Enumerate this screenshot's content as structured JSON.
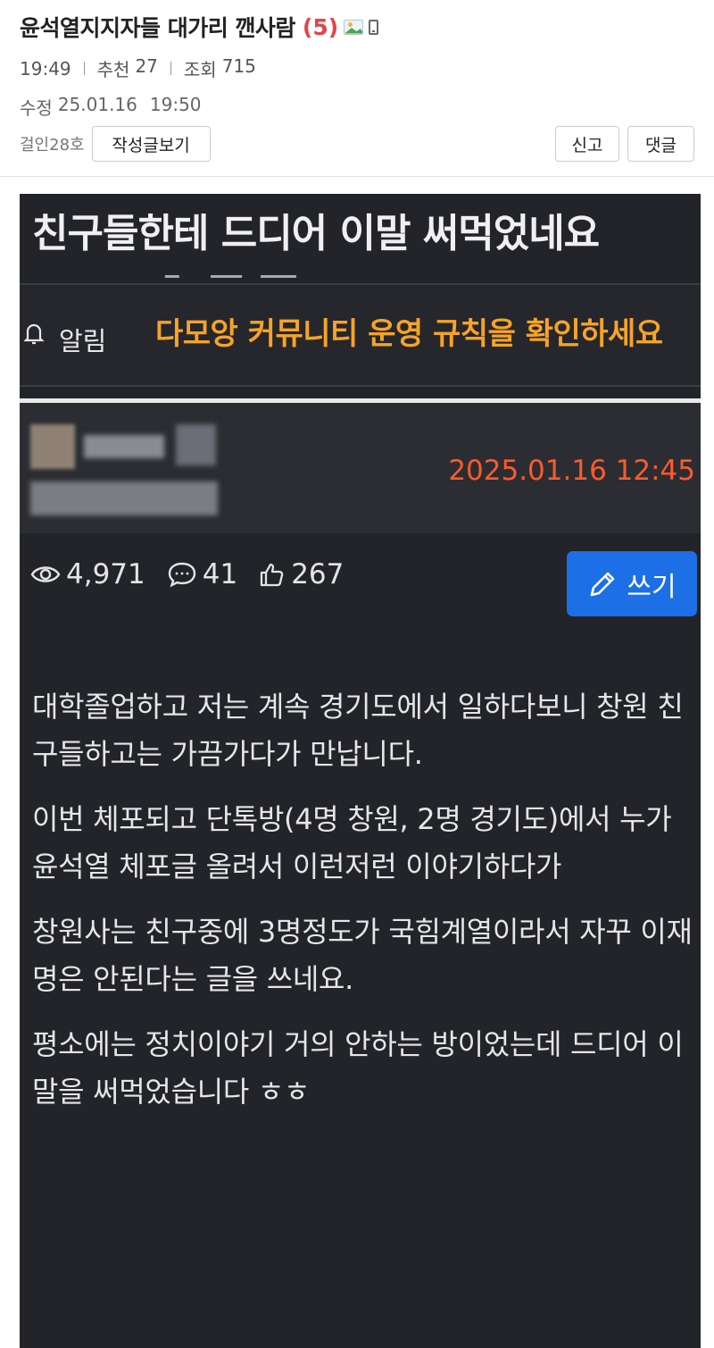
{
  "post": {
    "title": "윤석열지지자들 대가리 깬사람",
    "comment_count": "(5)",
    "time": "19:49",
    "recommend_label": "추천",
    "recommend_value": "27",
    "views_label": "조회",
    "views_value": "715",
    "edit_label": "수정",
    "edit_date": "25.01.16",
    "edit_time": "19:50",
    "author": "걸인28호",
    "view_posts_button": "작성글보기",
    "report_button": "신고",
    "comment_button": "댓글"
  },
  "screenshot": {
    "title": "친구들한테 드디어 이말 써먹었네요",
    "notice_label": "알림",
    "notice_text": "다모앙 커뮤니티 운영 규칙을 확인하세요",
    "date": "2025.01.16 12:45",
    "stats": {
      "views": "4,971",
      "comments": "41",
      "likes": "267"
    },
    "write_button": "쓰기",
    "paragraphs": [
      "대학졸업하고 저는 계속 경기도에서 일하다보니 창원 친구들하고는 가끔가다가 만납니다.",
      "이번 체포되고 단톡방(4명 창원, 2명 경기도)에서 누가 윤석열 체포글 올려서 이런저런 이야기하다가",
      "창원사는 친구중에 3명정도가 국힘계열이라서 자꾸 이재명은 안된다는 글을 쓰네요.",
      "평소에는 정치이야기 거의 안하는 방이었는데 드디어 이말을 써먹었습니다 ㅎㅎ"
    ]
  },
  "colors": {
    "comment_count": "#e0464b",
    "date": "#ff5a2d",
    "notice": "#f6a328",
    "write_button": "#1d6fe6",
    "dark_bg": "#222429"
  }
}
